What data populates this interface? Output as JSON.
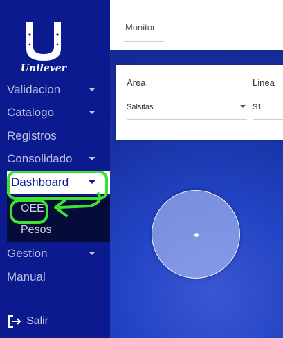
{
  "brand": {
    "name": "Unilever"
  },
  "sidebar": {
    "items": [
      {
        "label": "Validacion",
        "has_caret": true
      },
      {
        "label": "Catalogo",
        "has_caret": true
      },
      {
        "label": "Registros",
        "has_caret": false
      },
      {
        "label": "Consolidado",
        "has_caret": true
      },
      {
        "label": "Dashboard",
        "has_caret": true,
        "active": true
      },
      {
        "label": "Gestion",
        "has_caret": true
      },
      {
        "label": "Manual",
        "has_caret": false
      }
    ],
    "dashboard_submenu": [
      {
        "label": "OEE"
      },
      {
        "label": "Pesos"
      }
    ],
    "logout": {
      "label": "Salir",
      "icon": "logout-icon"
    }
  },
  "topbar": {
    "tab_label": "Monitor"
  },
  "filters": {
    "area": {
      "label": "Area",
      "value": "Salsitas"
    },
    "linea": {
      "label": "Linea",
      "value": "S1"
    }
  },
  "colors": {
    "sidebar_bg": "#0b1a8f",
    "submenu_bg": "#050c3a",
    "content_bg": "#1c36ad",
    "annotation_green": "#39e32f"
  }
}
